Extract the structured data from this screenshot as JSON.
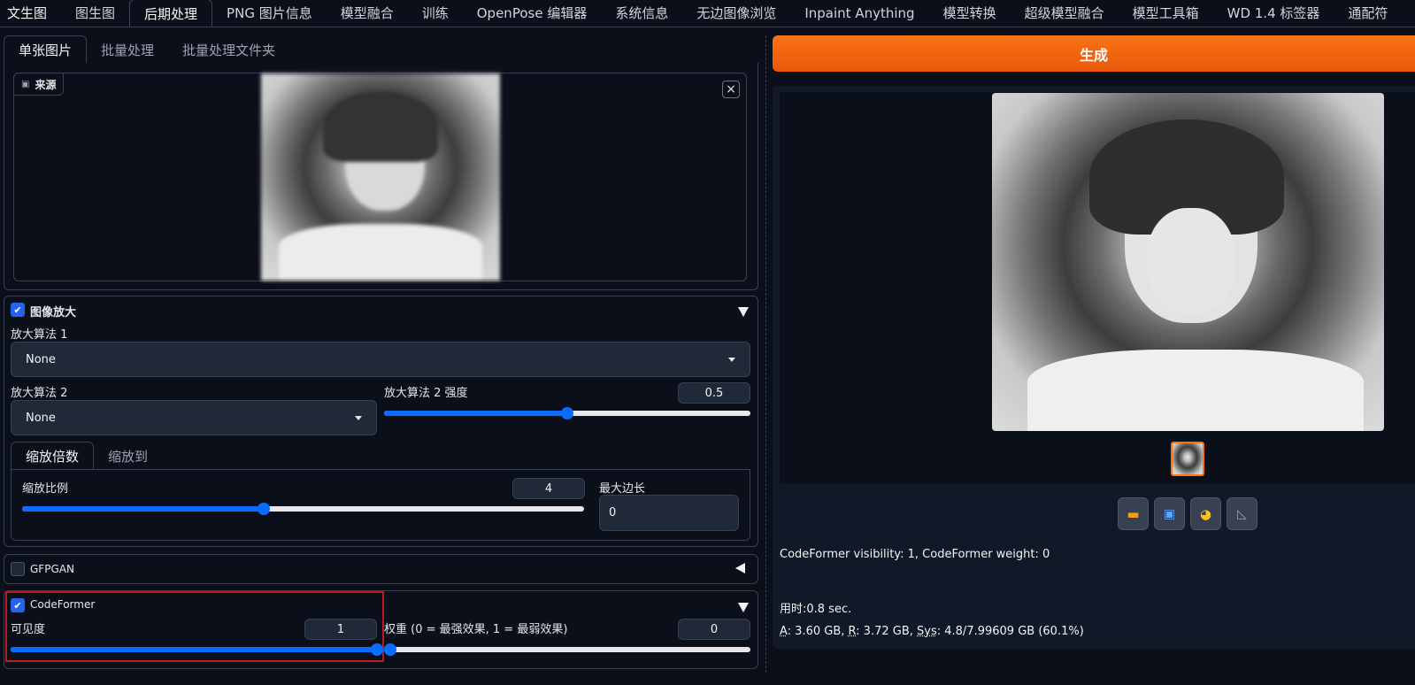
{
  "top_tabs": [
    "文生图",
    "图生图",
    "后期处理",
    "PNG 图片信息",
    "模型融合",
    "训练",
    "OpenPose 编辑器",
    "系统信息",
    "无边图像浏览",
    "Inpaint Anything",
    "模型转换",
    "超级模型融合",
    "模型工具箱",
    "WD 1.4 标签器",
    "通配符"
  ],
  "active_top_tab": "后期处理",
  "sub_tabs": [
    "单张图片",
    "批量处理",
    "批量处理文件夹"
  ],
  "source": {
    "label": "来源",
    "close_symbol": "×"
  },
  "upscale": {
    "enabled": true,
    "title": "图像放大",
    "upscaler1_label": "放大算法 1",
    "upscaler1_value": "None",
    "upscaler2_label": "放大算法 2",
    "upscaler2_value": "None",
    "upscaler2_strength_label": "放大算法 2 强度",
    "upscaler2_strength_value": "0.5",
    "upscaler2_strength_fraction": 0.5,
    "mode_tabs": [
      "缩放倍数",
      "缩放到"
    ],
    "scale_label": "缩放比例",
    "scale_value": "4",
    "scale_fraction": 0.43,
    "max_side_label": "最大边长",
    "max_side_value": "0"
  },
  "gfpgan": {
    "enabled": false,
    "title": "GFPGAN"
  },
  "codeformer": {
    "enabled": true,
    "title": "CodeFormer",
    "visibility_label": "可见度",
    "visibility_value": "1",
    "visibility_fraction": 1.0,
    "weight_label": "权重 (0 = 最强效果, 1 = 最弱效果)",
    "weight_value": "0",
    "weight_fraction": 0.0
  },
  "generate_button": "生成",
  "output": {
    "info_text": "CodeFormer visibility: 1, CodeFormer weight: 0",
    "time_text": "用时:0.8 sec.",
    "mem_A_label": "A",
    "mem_A_value": ": 3.60 GB, ",
    "mem_R_label": "R",
    "mem_R_value": ": 3.72 GB, ",
    "mem_Sys_label": "Sys",
    "mem_Sys_value": ": 4.8/7.99609 GB (60.1%)",
    "tool_icons": [
      "folder-icon",
      "image-icon",
      "palette-icon",
      "ruler-icon"
    ]
  },
  "colors": {
    "accent": "#f97316",
    "slider": "#0a6cff",
    "background": "#0b0f19",
    "highlight_box": "#b91c1c"
  }
}
